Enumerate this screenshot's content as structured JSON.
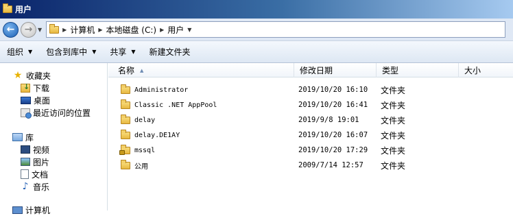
{
  "window": {
    "title": "用户"
  },
  "address": {
    "crumbs": [
      "计算机",
      "本地磁盘 (C:)",
      "用户"
    ]
  },
  "toolbar": {
    "organize": "组织",
    "include": "包含到库中",
    "share": "共享",
    "new_folder": "新建文件夹"
  },
  "sidebar": {
    "favorites": {
      "label": "收藏夹",
      "items": [
        "下载",
        "桌面",
        "最近访问的位置"
      ]
    },
    "libraries": {
      "label": "库",
      "items": [
        "视频",
        "图片",
        "文档",
        "音乐"
      ]
    },
    "computer": {
      "label": "计算机"
    }
  },
  "columns": {
    "name": "名称",
    "date": "修改日期",
    "type": "类型",
    "size": "大小"
  },
  "files": [
    {
      "name": "Administrator",
      "date": "2019/10/20 16:10",
      "type": "文件夹",
      "icon": "folder-icon"
    },
    {
      "name": "Classic .NET AppPool",
      "date": "2019/10/20 16:41",
      "type": "文件夹",
      "icon": "folder-icon"
    },
    {
      "name": "delay",
      "date": "2019/9/8 19:01",
      "type": "文件夹",
      "icon": "folder-icon"
    },
    {
      "name": "delay.DE1AY",
      "date": "2019/10/20 16:07",
      "type": "文件夹",
      "icon": "folder-icon"
    },
    {
      "name": "mssql",
      "date": "2019/10/20 17:29",
      "type": "文件夹",
      "icon": "locked-folder-icon"
    },
    {
      "name": "公用",
      "date": "2009/7/14 12:57",
      "type": "文件夹",
      "icon": "folder-icon"
    }
  ]
}
